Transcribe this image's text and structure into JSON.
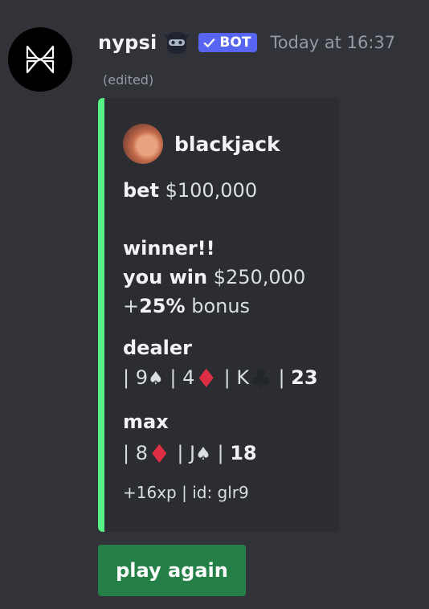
{
  "message": {
    "username": "nypsi",
    "bot_badge": "BOT",
    "timestamp": "Today at 16:37",
    "edited": "(edited)"
  },
  "embed": {
    "accent_color": "#57f287",
    "author": "blackjack",
    "bet_label": "bet",
    "bet_value": "$100,000",
    "result": "winner!!",
    "win_label": "you win",
    "win_value": "$250,000",
    "bonus_prefix": "+",
    "bonus_percent": "25%",
    "bonus_suffix": "bonus",
    "dealer": {
      "label": "dealer",
      "cards": [
        {
          "rank": "9",
          "suit": "spades"
        },
        {
          "rank": "4",
          "suit": "diamonds"
        },
        {
          "rank": "K",
          "suit": "clubs"
        }
      ],
      "total": "23"
    },
    "player": {
      "label": "max",
      "cards": [
        {
          "rank": "8",
          "suit": "diamonds"
        },
        {
          "rank": "J",
          "suit": "spades"
        }
      ],
      "total": "18"
    },
    "footer": "+16xp | id: glr9"
  },
  "button": {
    "label": "play again",
    "color": "#248046"
  }
}
